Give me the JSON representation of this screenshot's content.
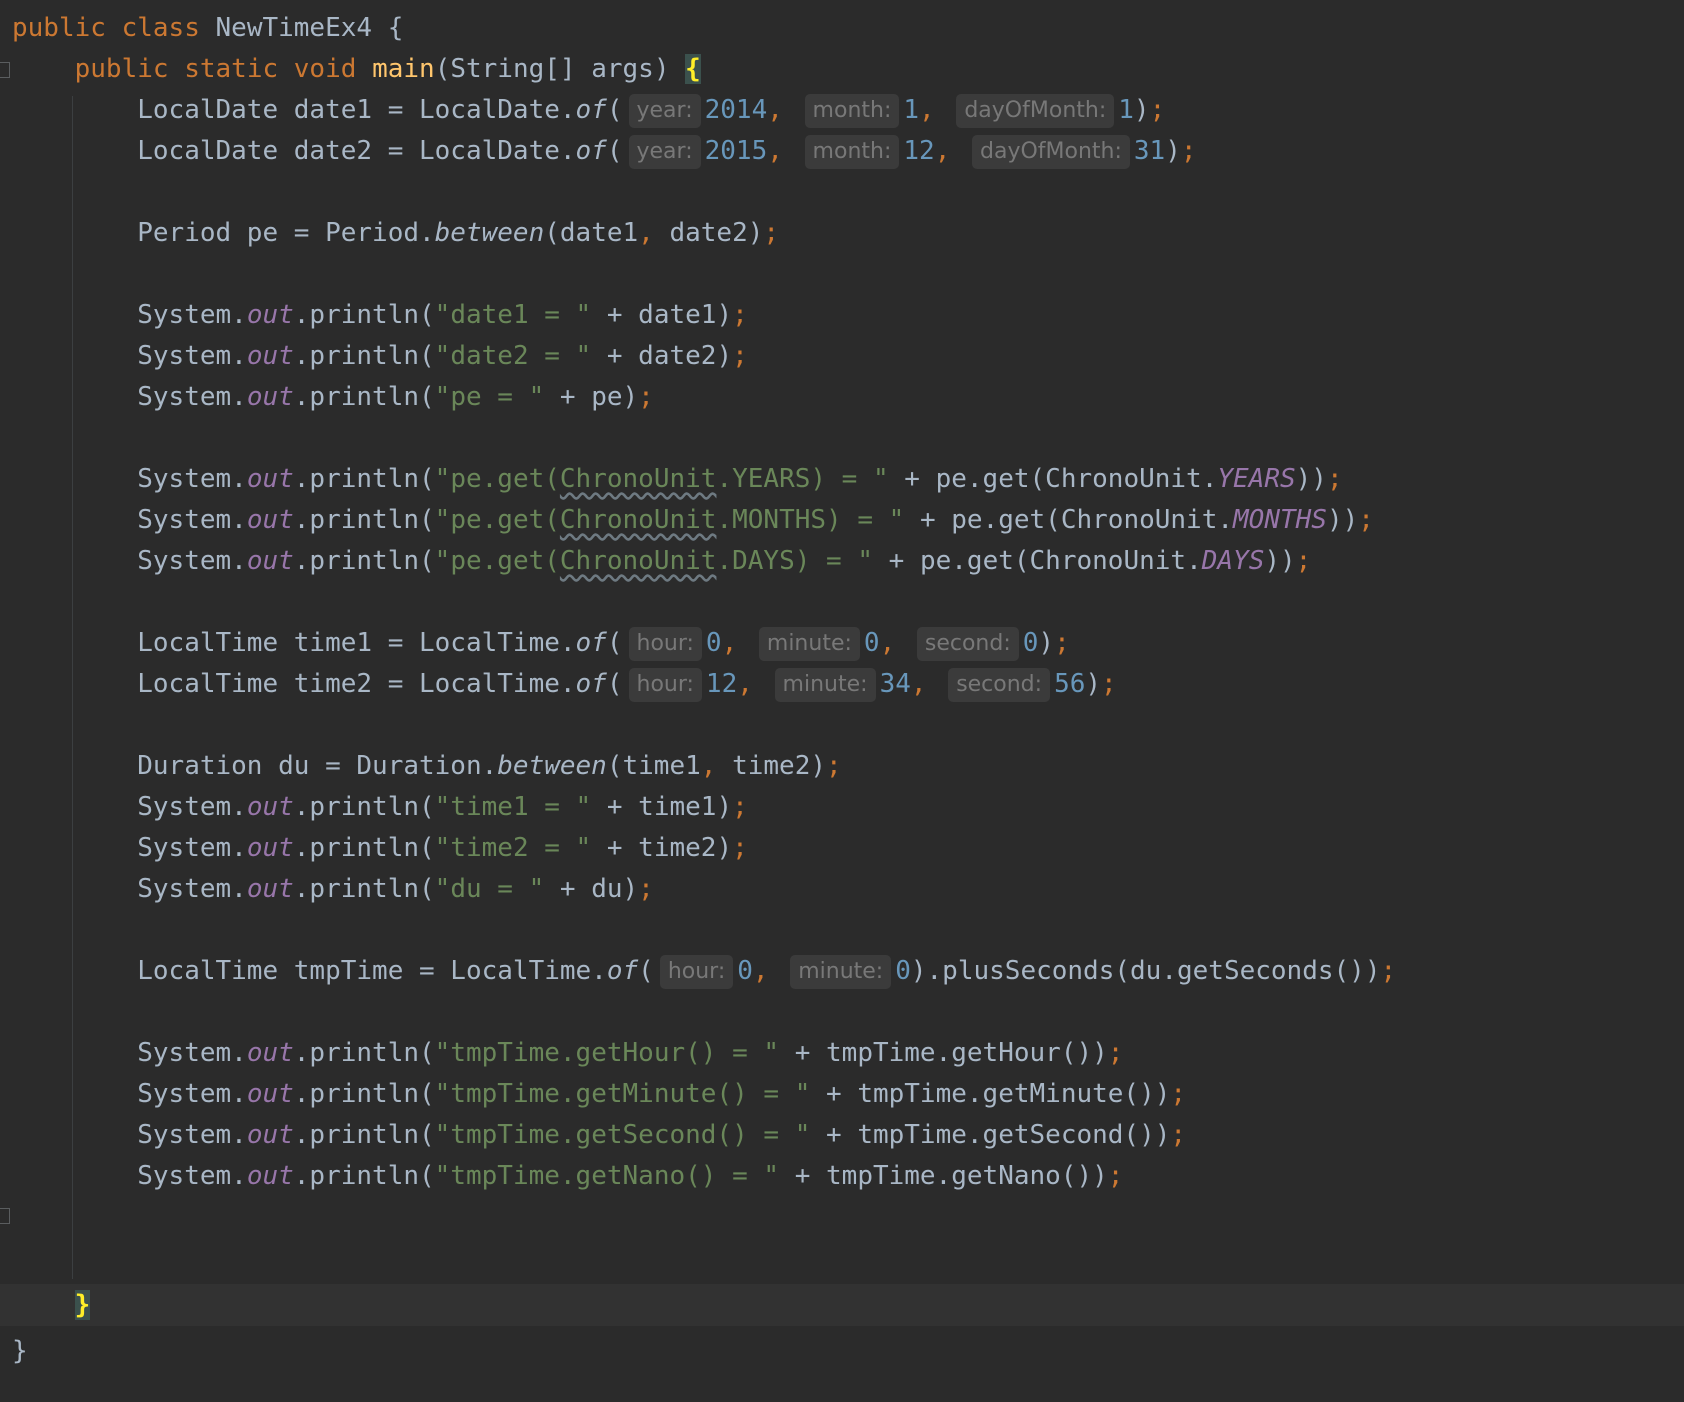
{
  "editor": {
    "class_decl": {
      "modifier": "public",
      "kw_class": "class",
      "name": "NewTimeEx4",
      "open": "{"
    },
    "method_decl": {
      "mod1": "public",
      "mod2": "static",
      "ret": "void",
      "name": "main",
      "params": "(String[] args)",
      "open": "{"
    },
    "date1": {
      "lead": "LocalDate date1 = LocalDate.",
      "method": "of",
      "open": "(",
      "h1": "year:",
      "v1": "2014",
      "h2": "month:",
      "v2": "1",
      "h3": "dayOfMonth:",
      "v3": "1",
      "close": ")"
    },
    "date2": {
      "lead": "LocalDate date2 = LocalDate.",
      "method": "of",
      "open": "(",
      "h1": "year:",
      "v1": "2015",
      "h2": "month:",
      "v2": "12",
      "h3": "dayOfMonth:",
      "v3": "31",
      "close": ")"
    },
    "period": {
      "lead": "Period pe = Period.",
      "method": "between",
      "args_a": "(date1",
      "args_b": " date2)"
    },
    "print_date1": {
      "sys": "System.",
      "out": "out",
      "call": ".println(",
      "str": "\"date1 = \"",
      "rest": " + date1)"
    },
    "print_date2": {
      "sys": "System.",
      "out": "out",
      "call": ".println(",
      "str": "\"date2 = \"",
      "rest": " + date2)"
    },
    "print_pe": {
      "sys": "System.",
      "out": "out",
      "call": ".println(",
      "str": "\"pe = \"",
      "rest": " + pe)"
    },
    "print_years": {
      "sys": "System.",
      "out": "out",
      "call": ".println(",
      "str_a": "\"pe.get(",
      "str_w": "ChronoUnit",
      "str_b": ".YEARS) = \"",
      "mid": " + pe.get(ChronoUnit.",
      "const": "YEARS",
      "end": "))"
    },
    "print_months": {
      "sys": "System.",
      "out": "out",
      "call": ".println(",
      "str_a": "\"pe.get(",
      "str_w": "ChronoUnit",
      "str_b": ".MONTHS) = \"",
      "mid": " + pe.get(ChronoUnit.",
      "const": "MONTHS",
      "end": "))"
    },
    "print_days": {
      "sys": "System.",
      "out": "out",
      "call": ".println(",
      "str_a": "\"pe.get(",
      "str_w": "ChronoUnit",
      "str_b": ".DAYS) = \"",
      "mid": " + pe.get(ChronoUnit.",
      "const": "DAYS",
      "end": "))"
    },
    "time1": {
      "lead": "LocalTime time1 = LocalTime.",
      "method": "of",
      "open": "(",
      "h1": "hour:",
      "v1": "0",
      "h2": "minute:",
      "v2": "0",
      "h3": "second:",
      "v3": "0",
      "close": ")"
    },
    "time2": {
      "lead": "LocalTime time2 = LocalTime.",
      "method": "of",
      "open": "(",
      "h1": "hour:",
      "v1": "12",
      "h2": "minute:",
      "v2": "34",
      "h3": "second:",
      "v3": "56",
      "close": ")"
    },
    "duration": {
      "lead": "Duration du = Duration.",
      "method": "between",
      "args_a": "(time1",
      "args_b": " time2)"
    },
    "print_time1": {
      "sys": "System.",
      "out": "out",
      "call": ".println(",
      "str": "\"time1 = \"",
      "rest": " + time1)"
    },
    "print_time2": {
      "sys": "System.",
      "out": "out",
      "call": ".println(",
      "str": "\"time2 = \"",
      "rest": " + time2)"
    },
    "print_du": {
      "sys": "System.",
      "out": "out",
      "call": ".println(",
      "str": "\"du = \"",
      "rest": " + du)"
    },
    "tmptime": {
      "lead": "LocalTime tmpTime = LocalTime.",
      "method": "of",
      "open": "(",
      "h1": "hour:",
      "v1": "0",
      "h2": "minute:",
      "v2": "0",
      "rest": ").plusSeconds(du.getSeconds())"
    },
    "print_hour": {
      "sys": "System.",
      "out": "out",
      "call": ".println(",
      "str": "\"tmpTime.getHour() = \"",
      "rest": " + tmpTime.getHour())"
    },
    "print_minute": {
      "sys": "System.",
      "out": "out",
      "call": ".println(",
      "str": "\"tmpTime.getMinute() = \"",
      "rest": " + tmpTime.getMinute())"
    },
    "print_second": {
      "sys": "System.",
      "out": "out",
      "call": ".println(",
      "str": "\"tmpTime.getSecond() = \"",
      "rest": " + tmpTime.getSecond())"
    },
    "print_nano": {
      "sys": "System.",
      "out": "out",
      "call": ".println(",
      "str": "\"tmpTime.getNano() = \"",
      "rest": " + tmpTime.getNano())"
    },
    "method_close": "}",
    "class_close": "}",
    "semicolon": ";",
    "comma": ","
  },
  "colors": {
    "background": "#2b2b2b",
    "keyword": "#cc7832",
    "method_decl": "#ffc66d",
    "number": "#6897bb",
    "string": "#6a8759",
    "field": "#9876aa",
    "text": "#a9b7c6",
    "hint_bg": "#3b3b3b",
    "hint_text": "#787878",
    "brace_match": "#ffef28"
  }
}
